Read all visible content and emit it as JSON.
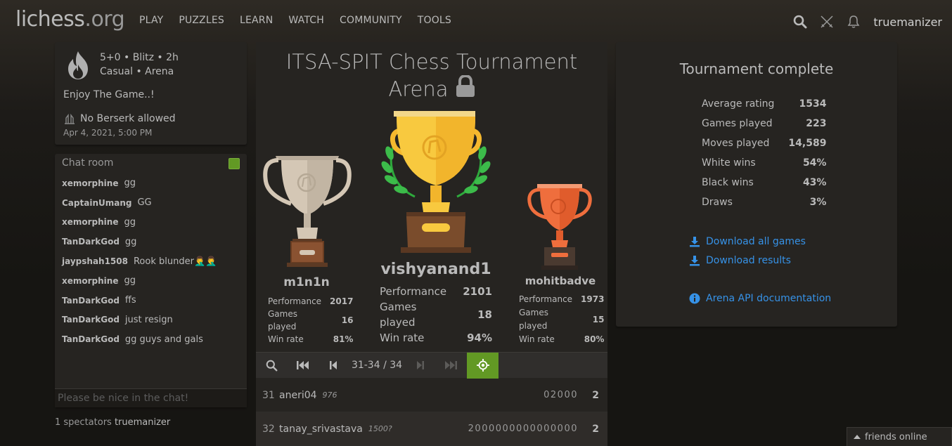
{
  "header": {
    "logo_main": "lichess",
    "logo_tld": ".org",
    "nav": [
      "PLAY",
      "PUZZLES",
      "LEARN",
      "WATCH",
      "COMMUNITY",
      "TOOLS"
    ],
    "username": "truemanizer"
  },
  "info": {
    "setup_line1": "5+0 • Blitz • 2h",
    "setup_line2": "Casual • Arena",
    "description": "Enjoy The Game..!",
    "berserk": "No Berserk allowed",
    "date": "Apr 4, 2021, 5:00 PM"
  },
  "chat": {
    "title": "Chat room",
    "placeholder": "Please be nice in the chat!",
    "lines": [
      {
        "user": "xemorphine",
        "text": "gg"
      },
      {
        "user": "CaptainUmang",
        "text": "GG"
      },
      {
        "user": "xemorphine",
        "text": "gg"
      },
      {
        "user": "TanDarkGod",
        "text": "gg"
      },
      {
        "user": "jaypshah1508",
        "text": "Rook blunder🤦‍♂️🤦‍♂️"
      },
      {
        "user": "xemorphine",
        "text": "gg"
      },
      {
        "user": "TanDarkGod",
        "text": "ffs"
      },
      {
        "user": "TanDarkGod",
        "text": "just resign"
      },
      {
        "user": "TanDarkGod",
        "text": "gg guys and gals"
      }
    ]
  },
  "spectators": {
    "label": "1 spectators",
    "names": "truemanizer"
  },
  "tournament": {
    "title_line1": "ITSA-SPIT Chess Tournament",
    "title_line2": "Arena"
  },
  "podium": {
    "first": {
      "name": "vishyanand1",
      "performance_label": "Performance",
      "performance": "2101",
      "games_label": "Games played",
      "games": "18",
      "winrate_label": "Win rate",
      "winrate": "94%"
    },
    "second": {
      "name": "m1n1n",
      "performance_label": "Performance",
      "performance": "2017",
      "games_label": "Games played",
      "games": "16",
      "winrate_label": "Win rate",
      "winrate": "81%"
    },
    "third": {
      "name": "mohitbadve",
      "performance_label": "Performance",
      "performance": "1973",
      "games_label": "Games played",
      "games": "15",
      "winrate_label": "Win rate",
      "winrate": "80%"
    }
  },
  "pager": {
    "position": "31-34 / 34"
  },
  "standings": [
    {
      "rank": "31",
      "player": "aneri04",
      "rating": "976",
      "sheet": "02000",
      "total": "2"
    },
    {
      "rank": "32",
      "player": "tanay_srivastava",
      "rating": "1500?",
      "sheet": "2000000000000000",
      "total": "2"
    }
  ],
  "complete": {
    "title": "Tournament complete",
    "stats": [
      {
        "label": "Average rating",
        "value": "1534"
      },
      {
        "label": "Games played",
        "value": "223"
      },
      {
        "label": "Moves played",
        "value": "14,589"
      },
      {
        "label": "White wins",
        "value": "54%"
      },
      {
        "label": "Black wins",
        "value": "43%"
      },
      {
        "label": "Draws",
        "value": "3%"
      }
    ],
    "download_games": "Download all games",
    "download_results": "Download results",
    "api_docs": "Arena API documentation"
  },
  "friends": "friends online",
  "colors": {
    "accent_green": "#629924",
    "link_blue": "#3692e7",
    "gold": "#f5b82e",
    "silver": "#d4c7b5",
    "bronze": "#ef6e3d"
  }
}
